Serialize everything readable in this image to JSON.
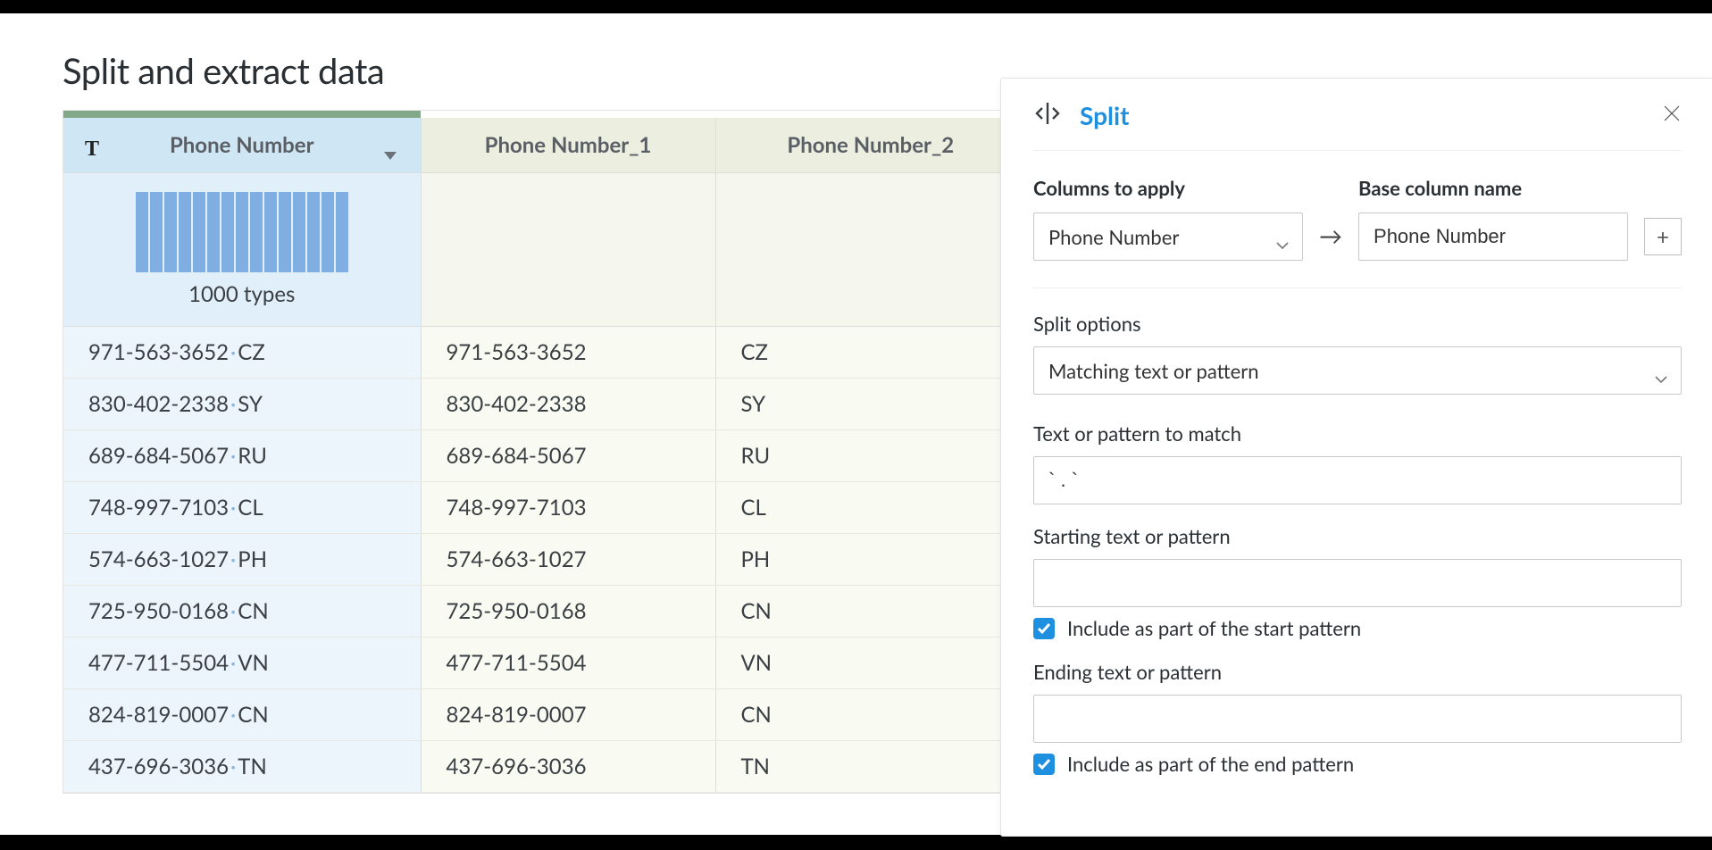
{
  "title": "Split and extract data",
  "columns": [
    {
      "label": "Phone Number",
      "selected": true,
      "type_icon": "T",
      "has_chevron": true
    },
    {
      "label": "Phone Number_1",
      "selected": false,
      "type_icon": "",
      "has_chevron": false
    },
    {
      "label": "Phone Number_2",
      "selected": false,
      "type_icon": "",
      "has_chevron": false
    }
  ],
  "profile": {
    "types_label": "1000 types"
  },
  "rows": [
    {
      "phone": "971-563-3652",
      "cc": "CZ"
    },
    {
      "phone": "830-402-2338",
      "cc": "SY"
    },
    {
      "phone": "689-684-5067",
      "cc": "RU"
    },
    {
      "phone": "748-997-7103",
      "cc": "CL"
    },
    {
      "phone": "574-663-1027",
      "cc": "PH"
    },
    {
      "phone": "725-950-0168",
      "cc": "CN"
    },
    {
      "phone": "477-711-5504",
      "cc": "VN"
    },
    {
      "phone": "824-819-0007",
      "cc": "CN"
    },
    {
      "phone": "437-696-3036",
      "cc": "TN"
    }
  ],
  "panel": {
    "title": "Split",
    "columns_to_apply_label": "Columns to apply",
    "columns_to_apply_value": "Phone Number",
    "base_column_label": "Base column name",
    "base_column_value": "Phone Number",
    "split_options_label": "Split options",
    "split_options_value": "Matching text or pattern",
    "pattern_label": "Text or pattern to match",
    "pattern_value": "` . `",
    "start_label": "Starting text or pattern",
    "start_value": "",
    "start_include_label": "Include as part of the start pattern",
    "start_include_checked": true,
    "end_label": "Ending text or pattern",
    "end_value": "",
    "end_include_label": "Include as part of the end pattern",
    "end_include_checked": true
  }
}
